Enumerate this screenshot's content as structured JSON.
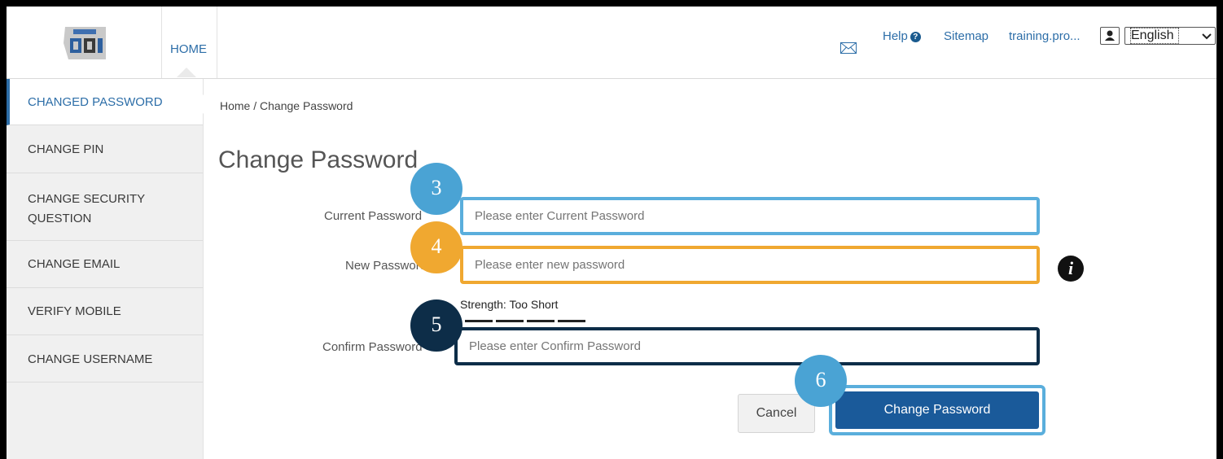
{
  "header": {
    "home_tab": "HOME",
    "help": "Help",
    "sitemap": "Sitemap",
    "user": "training.pro...",
    "language": "English",
    "icons": [
      "logo-icon",
      "mail-icon",
      "help-icon",
      "user-icon",
      "chevron-down-icon"
    ]
  },
  "sidebar": {
    "items": [
      {
        "label": "CHANGED PASSWORD"
      },
      {
        "label": "CHANGE PIN"
      },
      {
        "label": "CHANGE SECURITY QUESTION"
      },
      {
        "label": "CHANGE EMAIL"
      },
      {
        "label": "VERIFY MOBILE"
      },
      {
        "label": "CHANGE USERNAME"
      }
    ]
  },
  "main": {
    "breadcrumb": "Home / Change Password",
    "title": "Change Password",
    "fields": {
      "current": {
        "label": "Current Password",
        "placeholder": "Please enter Current Password"
      },
      "new": {
        "label": "New Password",
        "placeholder": "Please enter new password"
      },
      "confirm": {
        "label": "Confirm Password",
        "placeholder": "Please enter Confirm Password"
      }
    },
    "strength": "Strength: Too Short",
    "cancel": "Cancel",
    "submit": "Change Password"
  },
  "annotations": {
    "badges": [
      "3",
      "4",
      "5",
      "6"
    ],
    "colors": {
      "light_blue": "#5aaedc",
      "orange": "#f0a830",
      "navy": "#0d2d48"
    }
  }
}
